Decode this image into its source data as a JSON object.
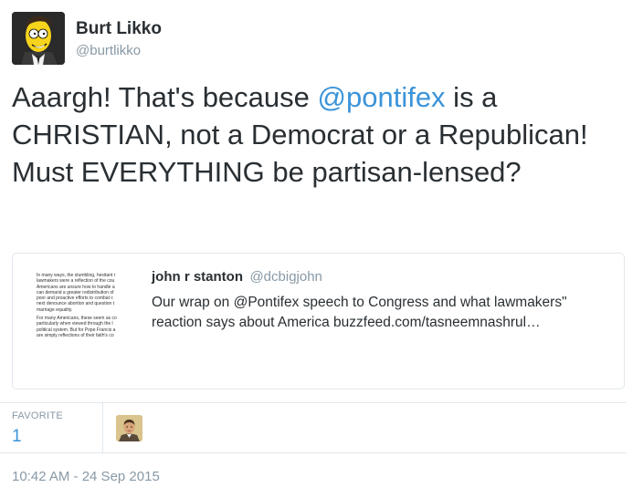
{
  "author": {
    "name": "Burt Likko",
    "handle": "@burtlikko",
    "avatar_icon": "simpsons-cartoon-avatar"
  },
  "tweet": {
    "text_before": "Aaargh! That's because ",
    "mention": "@pontifex",
    "text_after": " is a CHRISTIAN, not a Democrat or a Republican! Must EVERYTHING be partisan-lensed?"
  },
  "quote": {
    "name": "john r stanton",
    "handle": "@dcbigjohn",
    "text": "Our wrap on @Pontifex speech to Congress and what lawmakers\" reaction says about America buzzfeed.com/tasneemnashrul…",
    "thumbnail_lines": [
      "In many ways, the stumbling, hesitant r",
      "lawmakers were a reflection of the cou",
      "Americans are unsure how to handle a",
      "can demand a greater redistribution of",
      "poor and proactive efforts to combat c",
      "next denounce abortion and question t",
      "marriage equality.",
      "",
      "For many Americans, these seem as co",
      "particularly when viewed through the l",
      "political system. But for Pope Francis a",
      "are simply reflections of their faith's co"
    ]
  },
  "stats": {
    "favorite_label": "FAVORITE",
    "favorite_count": "1"
  },
  "timestamp": "10:42 AM - 24 Sep 2015",
  "colors": {
    "link": "#3b94d9",
    "text": "#292f33",
    "muted": "#8899a6",
    "border": "#e1e8ed"
  }
}
